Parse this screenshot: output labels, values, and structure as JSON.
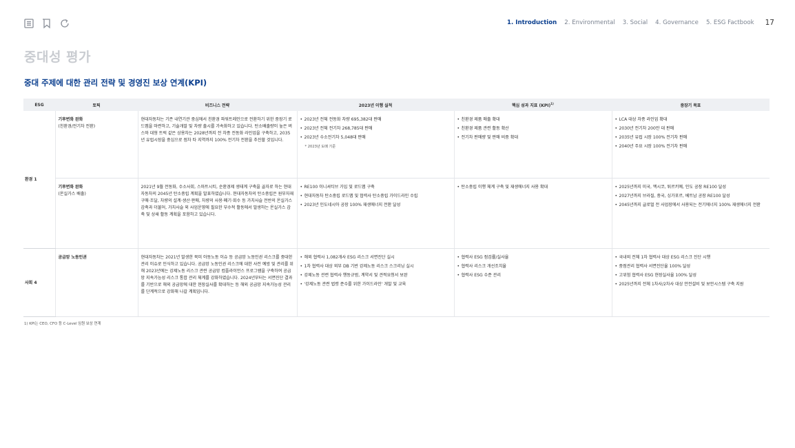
{
  "toolbar": {
    "icons": [
      "menu-icon",
      "bookmark-icon",
      "refresh-icon"
    ]
  },
  "nav": {
    "tabs": [
      "1. Introduction",
      "2. Environmental",
      "3. Social",
      "4. Governance",
      "5. ESG Factbook"
    ],
    "active_tab": "1. Introduction",
    "page_number": "17"
  },
  "section_title": "중대성 평가",
  "sub_title": "중대 주제에 대한 관리 전략 및 경영진 보상 연계(KPI)",
  "table": {
    "headers": {
      "esg": "ESG",
      "topic": "토픽",
      "strategy": "비즈니스 전략",
      "performance": "2023년 이행 실적",
      "kpi": "핵심 성과 지표 (KPI)",
      "kpi_sup": "1)",
      "target": "중장기 목표"
    },
    "groups": [
      {
        "esg": "환경 1",
        "rows": [
          {
            "topic_title": "기후변화 완화",
            "topic_sub": "(친환경/전기차 전환)",
            "strategy": "현대자동차는 기존 내연기관 중심에서 친환경 파워트레인으로 전환하기 위한 중장기 로드맵을 마련하고, 기술개발 및 차량 출시를 가속화하고 있습니다. 탄소배출량이 높은 버스와 대형 트럭 같은 상용차는 2028년까지 전 차종 전동화 라인업을 구축하고, 2035년 유럽시장을 중심으로 점차 타 지역까지 100% 전기차 전환을 추진할 것입니다.",
            "performance": [
              "2023년 전체 전동화 차량 695,382대 판매",
              "2023년 전체 전기차 268,785대 판매",
              "2023년 수소전기차 5,048대 판매"
            ],
            "performance_note": "* 2023년 도매 기준",
            "kpi": [
              "친환경 제품 매출 확대",
              "친환경 제품 관련 활동 확산",
              "전기차 판매량 및 판매 비중 확대"
            ],
            "target": [
              "LCA 대상 차종 라인업 확대",
              "2030년 전기차 200만 대 판매",
              "2035년 유럽 시장 100% 전기차 판매",
              "2040년 주요 시장 100% 전기차 판매"
            ]
          },
          {
            "topic_title": "기후변화 완화",
            "topic_sub": "(온실가스 배출)",
            "strategy": "2021년 9월 전동화, 수소사회, 스마트시티, 순환경제 생태계 구축을 골자로 하는 현대자동차의 2045년 탄소중립 계획을 발표하였습니다. 현대자동차의 탄소중립은 원부자재 구매·조달, 차량의 설계·생산·판매, 차량의 사용·폐기·회수 등 가치사슬 전반의 온실가스 감축과 더불어, 가치사슬 외 사업운영에 필요한 부수적 활동에서 발생하는 온실가스 감축 및 상쇄 활동 계획을 포함하고 있습니다.",
            "performance": [
              "RE100 이니셔티브 가입 및 로드맵 구축",
              "현대자동차 탄소중립 로드맵 및 협력사 탄소중립 가이드라인 수립",
              "2023년 인도네시아 공장 100% 재생에너지 전환 달성"
            ],
            "performance_note": "",
            "kpi": [
              "탄소중립 이행 체계 구축 및 재생에너지 사용 확대"
            ],
            "target": [
              "2025년까지 미국, 멕시코, 튀르키예, 인도 공장 RE100 달성",
              "2027년까지 브라질, 중국, 싱가포르, 베트남 공장 RE100 달성",
              "2045년까지 글로벌 전 사업장에서 사용되는 전기에너지 100% 재생에너지 전환"
            ]
          }
        ]
      },
      {
        "esg": "사회 4",
        "rows": [
          {
            "topic_title": "공급망 노동인권",
            "topic_sub": "",
            "strategy": "현대자동차는 2021년 발생한 북미 아동노동 이슈 등 공급망 노동인권 리스크를 중대한 관리 이슈로 인식하고 있습니다. 공급망 노동인권 리스크에 대한 사전 예방 및 관리를 위해 2023년에는 강제노동 리스크 관련 공급망 컴플라이언스 프로그램을 구축하여 공급망 지속가능성 리스크 통합 관리 체계를 강화하였습니다. 2024년부터는 서면진단 결과를 기반으로 해외 공급망에 대한 현장실사를 확대하는 등 해외 공급망 지속가능성 관리를 단계적으로 강화해 나갈 계획입니다.",
            "performance": [
              "해외 협력사 1,082개사 ESG 리스크 서면진단 실시",
              "1차 협력사 대상 외부 DB 기반 강제노동 리스크 스크리닝 실시",
              "강제노동 관련 협력사 행동규범, 계약서 및 견적요청서 보완",
              "'강제노동 관련 법령 준수를 위한 가이드라인' 개발 및 교육"
            ],
            "performance_note": "",
            "kpi": [
              "협력사 ESG 점검률/실사율",
              "협력사 리스크 개선조치율",
              "협력사 ESG 수준 관리"
            ],
            "target": [
              "국내외 전체 1차 협력사 대상 ESG 리스크 진단 시행",
              "중점관리 협력사 서면진단율 100% 달성",
              "고위험 협력사 ESG 현장실사율 100% 달성",
              "2025년까지 전체 1차사/2차사 대상 안전설비 및 보안시스템 구축 지원"
            ]
          }
        ]
      }
    ]
  },
  "footnote": "1) KPI는 CEO, CFO 등 C-Level 임원 보상 연계"
}
